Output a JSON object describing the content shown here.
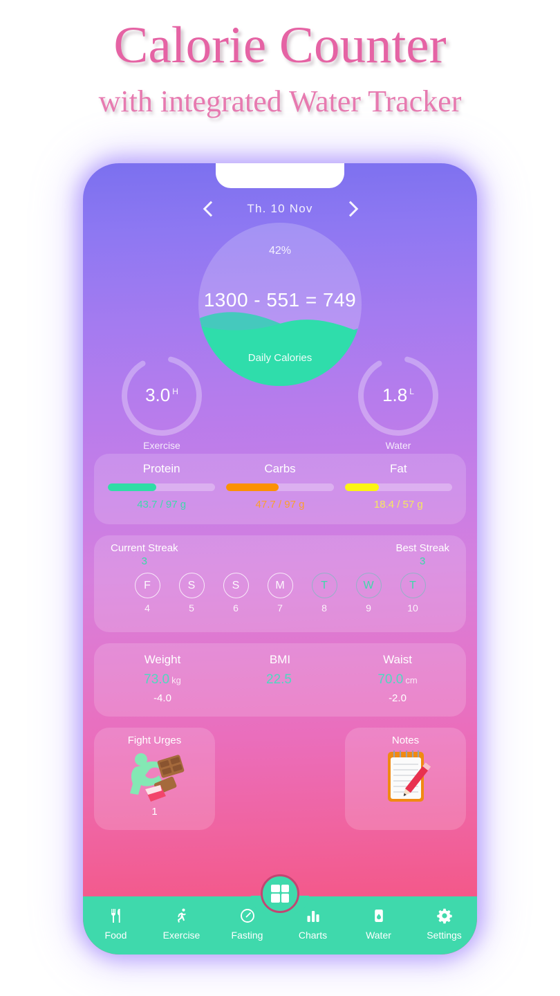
{
  "promo": {
    "title": "Calorie Counter",
    "subtitle": "with integrated Water Tracker",
    "title_color": "#e563a4"
  },
  "date_bar": {
    "prev_icon": "chevron-left-icon",
    "next_icon": "chevron-right-icon",
    "label": "Th.  10  Nov"
  },
  "calories": {
    "percent_label": "42%",
    "percent_value": 42,
    "equation": "1300 - 551 = 749",
    "goal": 1300,
    "consumed": 551,
    "remaining": 749,
    "caption": "Daily Calories",
    "wave_color": "#2fddab",
    "wave_back_color": "#45c9bd"
  },
  "gauges": [
    {
      "name": "exercise",
      "value": "3.0",
      "unit": "H",
      "label": "Exercise",
      "fraction": 0.62,
      "arc_color": "#3ef2f2",
      "track_color": "rgba(255,255,255,0.30)"
    },
    {
      "name": "water",
      "value": "1.8",
      "unit": "L",
      "label": "Water",
      "fraction": 0.62,
      "arc_color": "#3ef2f2",
      "track_color": "rgba(255,255,255,0.30)"
    }
  ],
  "macros": [
    {
      "name": "Protein",
      "value": "43.7 / 97 g",
      "current": 43.7,
      "target": 97,
      "fraction": 0.45,
      "color": "#2fdda6"
    },
    {
      "name": "Carbs",
      "value": "47.7 / 97 g",
      "current": 47.7,
      "target": 97,
      "fraction": 0.49,
      "color": "#fb9104"
    },
    {
      "name": "Fat",
      "value": "18.4 / 57 g",
      "current": 18.4,
      "target": 57,
      "fraction": 0.32,
      "color": "#fcf414"
    }
  ],
  "streak": {
    "current_label": "Current Streak",
    "current_value": "3",
    "best_label": "Best Streak",
    "best_value": "3",
    "days": [
      {
        "letter": "F",
        "num": "4",
        "active": false
      },
      {
        "letter": "S",
        "num": "5",
        "active": false
      },
      {
        "letter": "S",
        "num": "6",
        "active": false
      },
      {
        "letter": "M",
        "num": "7",
        "active": false
      },
      {
        "letter": "T",
        "num": "8",
        "active": true
      },
      {
        "letter": "W",
        "num": "9",
        "active": true
      },
      {
        "letter": "T",
        "num": "10",
        "active": true
      }
    ]
  },
  "body": [
    {
      "name": "Weight",
      "value": "73.0",
      "unit": "kg",
      "delta": "-4.0"
    },
    {
      "name": "BMI",
      "value": "22.5",
      "unit": "",
      "delta": ""
    },
    {
      "name": "Waist",
      "value": "70.0",
      "unit": "cm",
      "delta": "-2.0"
    }
  ],
  "tiles": [
    {
      "name": "fight-urges",
      "title": "Fight Urges",
      "icon": "kick-chocolate-icon",
      "count": "1"
    },
    {
      "name": "notes",
      "title": "Notes",
      "icon": "notepad-pencil-icon",
      "count": ""
    }
  ],
  "nav": {
    "fab_icon": "dashboard-grid-icon",
    "bar_color": "#3fd9ac",
    "items": [
      {
        "label": "Food",
        "icon": "fork-knife-icon"
      },
      {
        "label": "Exercise",
        "icon": "running-person-icon"
      },
      {
        "label": "Fasting",
        "icon": "speedometer-icon"
      },
      {
        "label": "Charts",
        "icon": "bar-chart-icon"
      },
      {
        "label": "Water",
        "icon": "water-glass-icon"
      },
      {
        "label": "Settings",
        "icon": "gear-icon"
      }
    ]
  }
}
